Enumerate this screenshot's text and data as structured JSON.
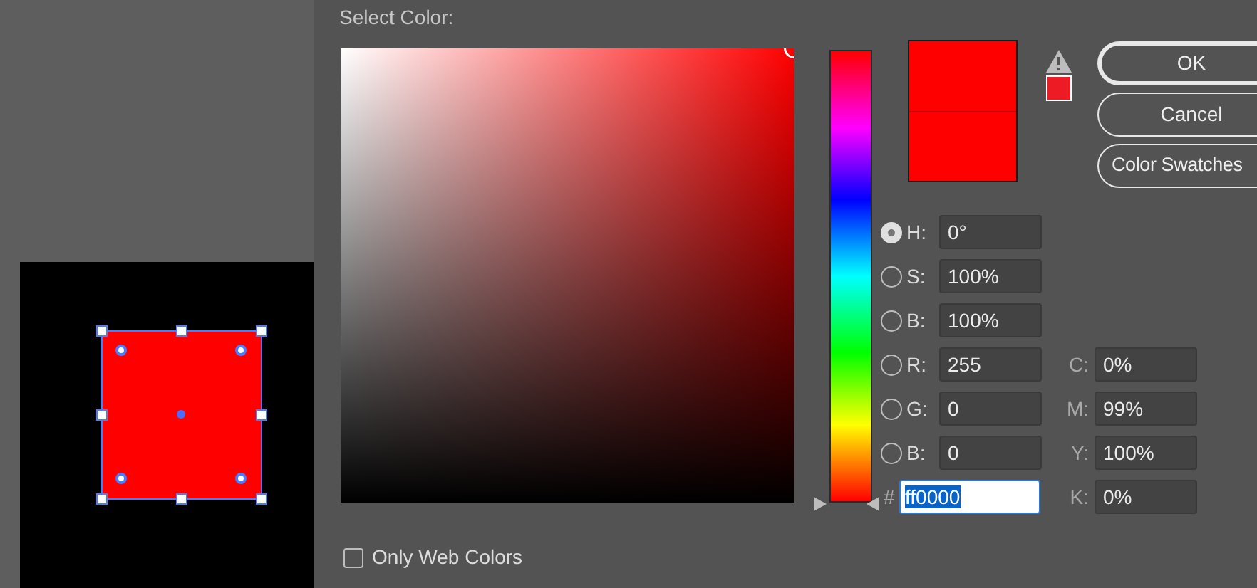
{
  "canvas": {
    "shape_selected": true
  },
  "dialog": {
    "title": "Select Color:",
    "hue_slider": {
      "level": 0
    },
    "gamut_warning": {
      "color": "#ed1c24"
    },
    "buttons": [
      {
        "label": "OK",
        "default": true
      },
      {
        "label": "Cancel",
        "default": false
      },
      {
        "label": "Color Swatches",
        "default": false
      }
    ],
    "hsb_rgb_fields": [
      {
        "label": "H:",
        "value": "0°",
        "selected": true
      },
      {
        "label": "S:",
        "value": "100%",
        "selected": false
      },
      {
        "label": "B:",
        "value": "100%",
        "selected": false
      },
      {
        "label": "R:",
        "value": "255",
        "selected": false
      },
      {
        "label": "G:",
        "value": "0",
        "selected": false
      },
      {
        "label": "B:",
        "value": "0",
        "selected": false
      }
    ],
    "hex_field": {
      "label": "#",
      "value": "ff0000",
      "text_selected": true
    },
    "cmyk_fields": [
      {
        "label": "C:",
        "value": "0%"
      },
      {
        "label": "M:",
        "value": "99%"
      },
      {
        "label": "Y:",
        "value": "100%"
      },
      {
        "label": "K:",
        "value": "0%"
      }
    ],
    "web_colors_checkbox": {
      "label": "Only Web Colors",
      "checked": false
    }
  }
}
